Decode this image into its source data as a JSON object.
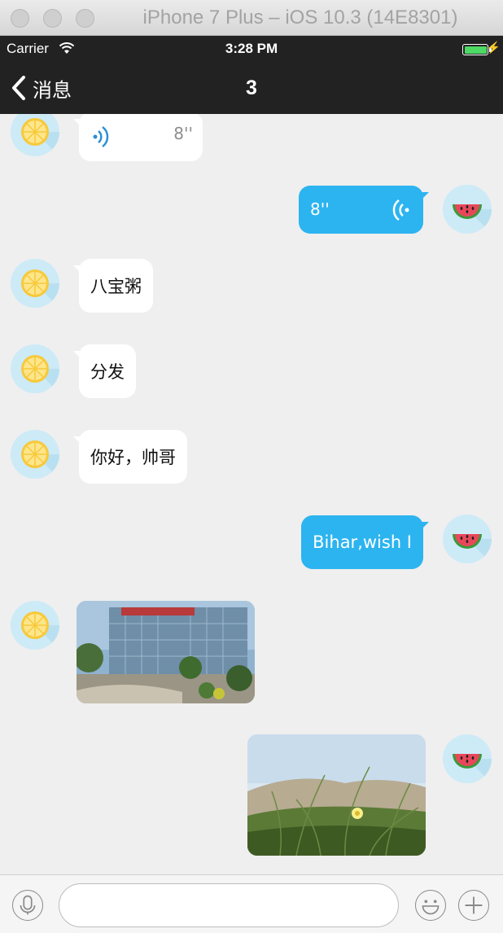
{
  "window": {
    "title": "iPhone 7 Plus – iOS 10.3 (14E8301)"
  },
  "status_bar": {
    "carrier": "Carrier",
    "time": "3:28 PM",
    "wifi_icon": "wifi-icon",
    "battery_icon": "battery-icon",
    "charging_icon": "bolt-icon"
  },
  "nav": {
    "back_label": "消息",
    "back_icon": "chevron-left-icon",
    "title": "3"
  },
  "messages": [
    {
      "direction": "incoming",
      "type": "voice",
      "duration": "8''",
      "avatar": "lemon-avatar"
    },
    {
      "direction": "outgoing",
      "type": "voice",
      "duration": "8''",
      "avatar": "watermelon-avatar"
    },
    {
      "direction": "incoming",
      "type": "text",
      "text": "八宝粥",
      "avatar": "lemon-avatar"
    },
    {
      "direction": "incoming",
      "type": "text",
      "text": "分发",
      "avatar": "lemon-avatar"
    },
    {
      "direction": "incoming",
      "type": "text",
      "text": "你好，帅哥",
      "avatar": "lemon-avatar"
    },
    {
      "direction": "outgoing",
      "type": "text",
      "text": "Bihar,wish I",
      "avatar": "watermelon-avatar"
    },
    {
      "direction": "incoming",
      "type": "image",
      "image": "building-photo",
      "avatar": "lemon-avatar"
    },
    {
      "direction": "outgoing",
      "type": "image",
      "image": "beach-grass-photo",
      "avatar": "watermelon-avatar"
    }
  ],
  "input_bar": {
    "mic_icon": "microphone-icon",
    "text_value": "",
    "placeholder": "",
    "emoji_icon": "smiley-icon",
    "plus_icon": "plus-icon"
  },
  "colors": {
    "outgoing_bubble": "#2cb4f0",
    "incoming_bubble": "#ffffff",
    "bar_background": "#222222",
    "chat_background": "#efefef"
  }
}
